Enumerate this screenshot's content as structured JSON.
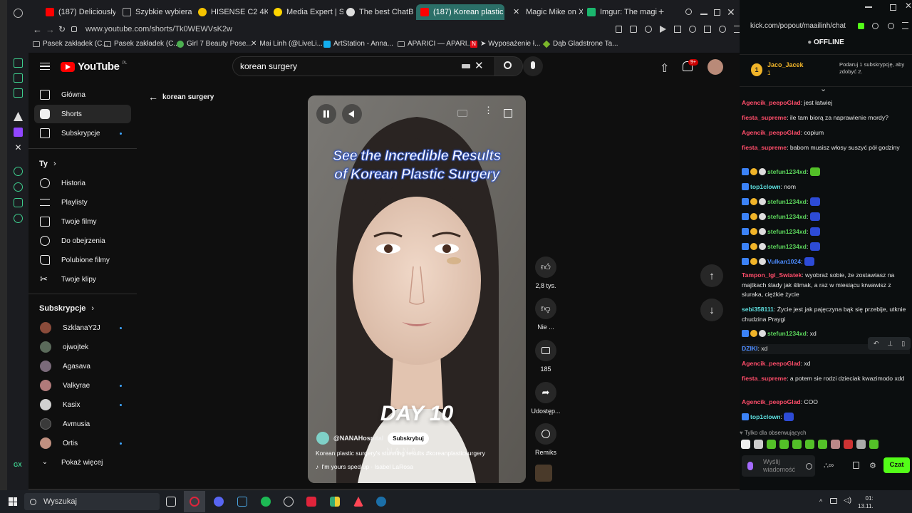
{
  "browser": {
    "tabs": [
      {
        "label": "(187) Deliciously Ea",
        "active": false
      },
      {
        "label": "Szybkie wybieranie",
        "active": false
      },
      {
        "label": "HISENSE C2 4K UH",
        "active": false
      },
      {
        "label": "Media Expert | Skle",
        "active": false
      },
      {
        "label": "The best ChatB",
        "active": false
      },
      {
        "label": "(187) Korean plastic s",
        "active": true
      },
      {
        "label": "Magic Mike on X: \"",
        "active": false
      },
      {
        "label": "Imgur: The magic o",
        "active": false
      }
    ],
    "url": "www.youtube.com/shorts/Tk0WEWVsK2w",
    "bookmarks": [
      "Pasek zakładek (C...",
      "Pasek zakładek (C...",
      "Girl 7 Beauty Pose...",
      "Mai Linh (@LiveLi...",
      "ArtStation - Anna...",
      "APARICI — APARI...",
      "➤ Wyposażenie ł...",
      "Dąb Gladstrone Ta..."
    ]
  },
  "youtube": {
    "logo": "YouTube",
    "region": "PL",
    "search_value": "korean surgery",
    "notif_count": "9+",
    "back_label": "korean surgery",
    "nav": [
      {
        "label": "Główna"
      },
      {
        "label": "Shorts"
      },
      {
        "label": "Subskrypcje"
      }
    ],
    "you_heading": "Ty",
    "you_items": [
      {
        "label": "Historia"
      },
      {
        "label": "Playlisty"
      },
      {
        "label": "Twoje filmy"
      },
      {
        "label": "Do obejrzenia"
      },
      {
        "label": "Polubione filmy"
      },
      {
        "label": "Twoje klipy"
      }
    ],
    "subs_heading": "Subskrypcje",
    "subs": [
      {
        "label": "SzklanaY2J",
        "dot": true,
        "color": "#8a4b3a"
      },
      {
        "label": "ojwojtek",
        "dot": false,
        "color": "#5a6a5a"
      },
      {
        "label": "Agasava",
        "dot": false,
        "color": "#7a6a7a"
      },
      {
        "label": "Valkyrae",
        "dot": true,
        "color": "#b07a7a"
      },
      {
        "label": "Kasix",
        "dot": true,
        "color": "#d0d0d0"
      },
      {
        "label": "Avmusia",
        "dot": false,
        "color": "#3a3a3a"
      },
      {
        "label": "Ortis",
        "dot": true,
        "color": "#c09080"
      }
    ],
    "show_more": "Pokaż więcej",
    "video": {
      "overlay_title_1": "See the Incredible Results",
      "overlay_title_2": "of Korean Plastic Surgery",
      "day_label": "DAY 10",
      "channel": "@NANAHospital",
      "subscribe": "Subskrybuj",
      "description": "Korean plastic surgery's stunning results #koreanplasticsurgery",
      "sound": "I'm yours sped up · Isabel LaRosa",
      "watermark": "NANA"
    },
    "actions": {
      "likes": "2,8 tys.",
      "dislike": "Nie ...",
      "comments": "185",
      "share": "Udostęp...",
      "remix": "Remiks"
    }
  },
  "kick": {
    "url": "kick.com/popout/maailinh/chat",
    "status": "OFFLINE",
    "top_user": "Jaco_Jacek",
    "top_user_count": "1",
    "promo": "Podaruj 1 subskrypcję, aby zdobyć 2.",
    "messages": [
      {
        "user": "Agencik_peepoGlad",
        "cls": "u-r",
        "badges": false,
        "text": "jest łatwiej"
      },
      {
        "user": "fiesta_supreme",
        "cls": "u-r",
        "badges": false,
        "text": "ile tam biorą za naprawienie mordy?"
      },
      {
        "user": "Agencik_peepoGlad",
        "cls": "u-r",
        "badges": false,
        "text": "copium"
      },
      {
        "user": "fiesta_supreme",
        "cls": "u-r",
        "badges": false,
        "text": "babom musisz włosy suszyć pół godziny"
      },
      {
        "user": "stefun1234xd",
        "cls": "u-g",
        "badges": true,
        "text": "",
        "emote": true
      },
      {
        "user": "top1clown",
        "cls": "u-c",
        "badges": false,
        "text": "nom"
      },
      {
        "user": "stefun1234xd",
        "cls": "u-g",
        "badges": true,
        "text": "",
        "emote": true
      },
      {
        "user": "stefun1234xd",
        "cls": "u-g",
        "badges": true,
        "text": "",
        "emote": true
      },
      {
        "user": "stefun1234xd",
        "cls": "u-g",
        "badges": true,
        "text": "",
        "emote": true
      },
      {
        "user": "stefun1234xd",
        "cls": "u-g",
        "badges": true,
        "text": "",
        "emote": true
      },
      {
        "user": "Vulkan1024",
        "cls": "u-b",
        "badges": true,
        "text": "",
        "emote": true
      },
      {
        "user": "Tampon_Igi_Swiatek",
        "cls": "u-r",
        "badges": false,
        "text": "wyobraź sobie, że zostawiasz na majtkach ślady jak ślimak, a raz w miesiącu krwawisz z siuraka, ciężkie życie"
      },
      {
        "user": "sebi358111",
        "cls": "u-c",
        "badges": false,
        "text": "Życie jest jak pajęczyna bąk się przebije, utknie chudzina Praygi"
      },
      {
        "user": "stefun1234xd",
        "cls": "u-g",
        "badges": true,
        "text": "xd"
      },
      {
        "user": "DZIKI",
        "cls": "u-b",
        "badges": false,
        "text": "xd"
      },
      {
        "user": "Agencik_peepoGlad",
        "cls": "u-r",
        "badges": false,
        "text": "xd"
      },
      {
        "user": "fiesta_supreme",
        "cls": "u-r",
        "badges": false,
        "text": "a potem sie rodzi dzieciak kwazimodo xdd"
      },
      {
        "user": "Agencik_peepoGlad",
        "cls": "u-r",
        "badges": false,
        "text": "COO"
      },
      {
        "user": "top1clown",
        "cls": "u-c",
        "badges": true,
        "text": "",
        "emote": true
      }
    ],
    "followers_only": "Tylko dla obserwujących",
    "input_placeholder": "Wyślij wiadomość",
    "chat_button": "Czat"
  },
  "taskbar": {
    "search_placeholder": "Wyszukaj",
    "time": "01:",
    "date": "13.11."
  },
  "colors": {
    "kick_green": "#53fc18",
    "yt_red": "#ff0000",
    "tab_active": "#2b6f68"
  }
}
